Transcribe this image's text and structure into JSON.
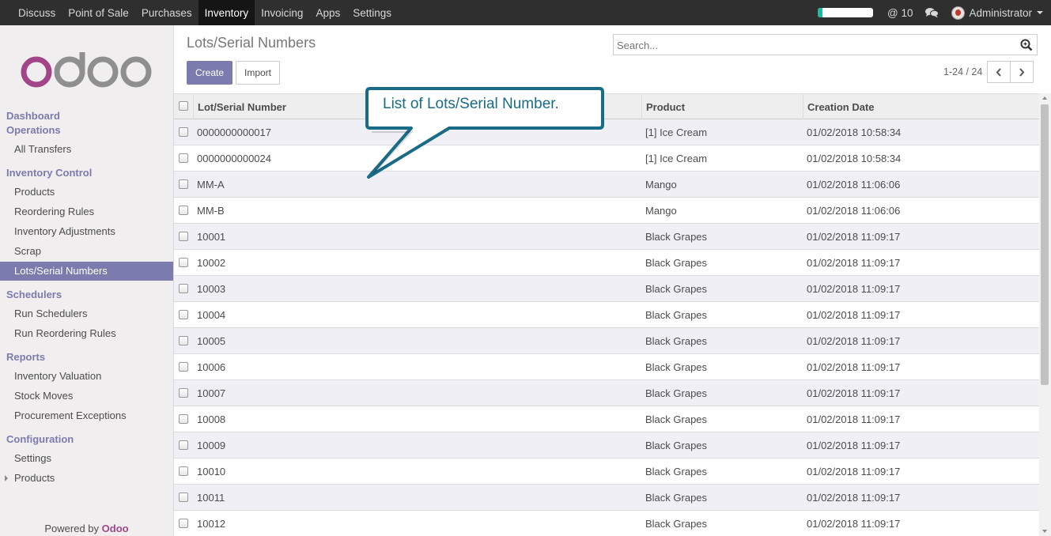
{
  "topbar": {
    "menu": [
      {
        "label": "Discuss",
        "active": false
      },
      {
        "label": "Point of Sale",
        "active": false
      },
      {
        "label": "Purchases",
        "active": false
      },
      {
        "label": "Inventory",
        "active": true
      },
      {
        "label": "Invoicing",
        "active": false
      },
      {
        "label": "Apps",
        "active": false
      },
      {
        "label": "Settings",
        "active": false
      }
    ],
    "mentions_count": "@ 10",
    "user_name": "Administrator",
    "progress_fraction": 0.08
  },
  "sidebar": {
    "sections": {
      "dashboard": "Dashboard",
      "operations": "Operations",
      "inventory_control": "Inventory Control",
      "schedulers": "Schedulers",
      "reports": "Reports",
      "configuration": "Configuration"
    },
    "links": {
      "all_transfers": "All Transfers",
      "products": "Products",
      "reordering_rules": "Reordering Rules",
      "inventory_adjustments": "Inventory Adjustments",
      "scrap": "Scrap",
      "lots_serial_numbers": "Lots/Serial Numbers",
      "run_schedulers": "Run Schedulers",
      "run_reordering_rules": "Run Reordering Rules",
      "inventory_valuation": "Inventory Valuation",
      "stock_moves": "Stock Moves",
      "procurement_exceptions": "Procurement Exceptions",
      "settings": "Settings",
      "config_products": "Products"
    },
    "powered_by": "Powered by",
    "powered_brand": "Odoo"
  },
  "control_panel": {
    "title": "Lots/Serial Numbers",
    "create_label": "Create",
    "import_label": "Import",
    "search_placeholder": "Search...",
    "pager": "1-24 / 24"
  },
  "table": {
    "columns": {
      "lot": "Lot/Serial Number",
      "product": "Product",
      "date": "Creation Date"
    },
    "rows": [
      {
        "lot": "0000000000017",
        "product": "[1] Ice Cream",
        "date": "01/02/2018 10:58:34"
      },
      {
        "lot": "0000000000024",
        "product": "[1] Ice Cream",
        "date": "01/02/2018 10:58:34"
      },
      {
        "lot": "MM-A",
        "product": "Mango",
        "date": "01/02/2018 11:06:06"
      },
      {
        "lot": "MM-B",
        "product": "Mango",
        "date": "01/02/2018 11:06:06"
      },
      {
        "lot": "10001",
        "product": "Black Grapes",
        "date": "01/02/2018 11:09:17"
      },
      {
        "lot": "10002",
        "product": "Black Grapes",
        "date": "01/02/2018 11:09:17"
      },
      {
        "lot": "10003",
        "product": "Black Grapes",
        "date": "01/02/2018 11:09:17"
      },
      {
        "lot": "10004",
        "product": "Black Grapes",
        "date": "01/02/2018 11:09:17"
      },
      {
        "lot": "10005",
        "product": "Black Grapes",
        "date": "01/02/2018 11:09:17"
      },
      {
        "lot": "10006",
        "product": "Black Grapes",
        "date": "01/02/2018 11:09:17"
      },
      {
        "lot": "10007",
        "product": "Black Grapes",
        "date": "01/02/2018 11:09:17"
      },
      {
        "lot": "10008",
        "product": "Black Grapes",
        "date": "01/02/2018 11:09:17"
      },
      {
        "lot": "10009",
        "product": "Black Grapes",
        "date": "01/02/2018 11:09:17"
      },
      {
        "lot": "10010",
        "product": "Black Grapes",
        "date": "01/02/2018 11:09:17"
      },
      {
        "lot": "10011",
        "product": "Black Grapes",
        "date": "01/02/2018 11:09:17"
      },
      {
        "lot": "10012",
        "product": "Black Grapes",
        "date": "01/02/2018 11:09:17"
      }
    ]
  },
  "callout": {
    "text": "List of Lots/Serial Number."
  },
  "colors": {
    "brand": "#7c7bad",
    "topbar": "#2f2f2f",
    "logo": "#a24689",
    "callout_border": "#1a6b86"
  }
}
